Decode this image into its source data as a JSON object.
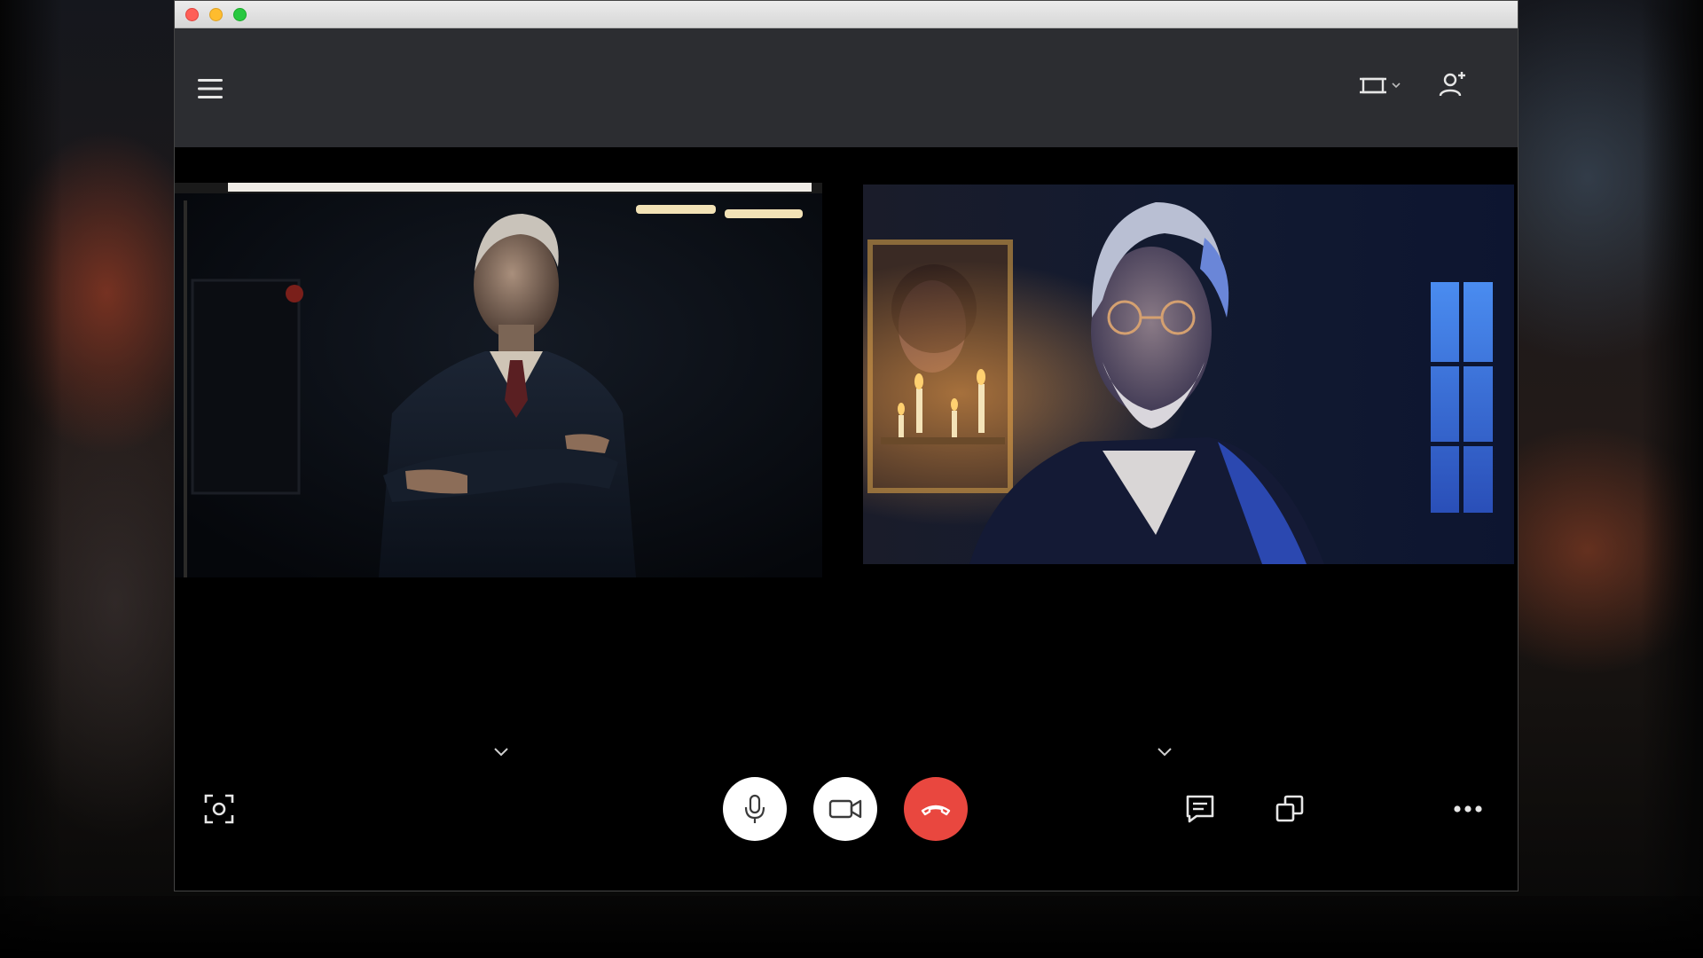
{
  "window": {
    "controls": [
      "close",
      "minimize",
      "zoom"
    ],
    "accent_red": "#e9473f"
  },
  "topbar": {
    "icons": [
      "menu-icon",
      "layout-icon",
      "add-person-icon"
    ]
  },
  "participants": [
    {
      "tile": "left",
      "kind": "video-feed"
    },
    {
      "tile": "right",
      "kind": "video-feed"
    }
  ],
  "controls": {
    "icons": [
      "screenshot-icon",
      "microphone-icon",
      "camera-icon",
      "end-call-icon",
      "chat-icon",
      "switch-view-icon",
      "more-icon"
    ],
    "end_call_color": "#e9473f",
    "mic_button_color": "#ffffff",
    "camera_button_color": "#ffffff"
  }
}
